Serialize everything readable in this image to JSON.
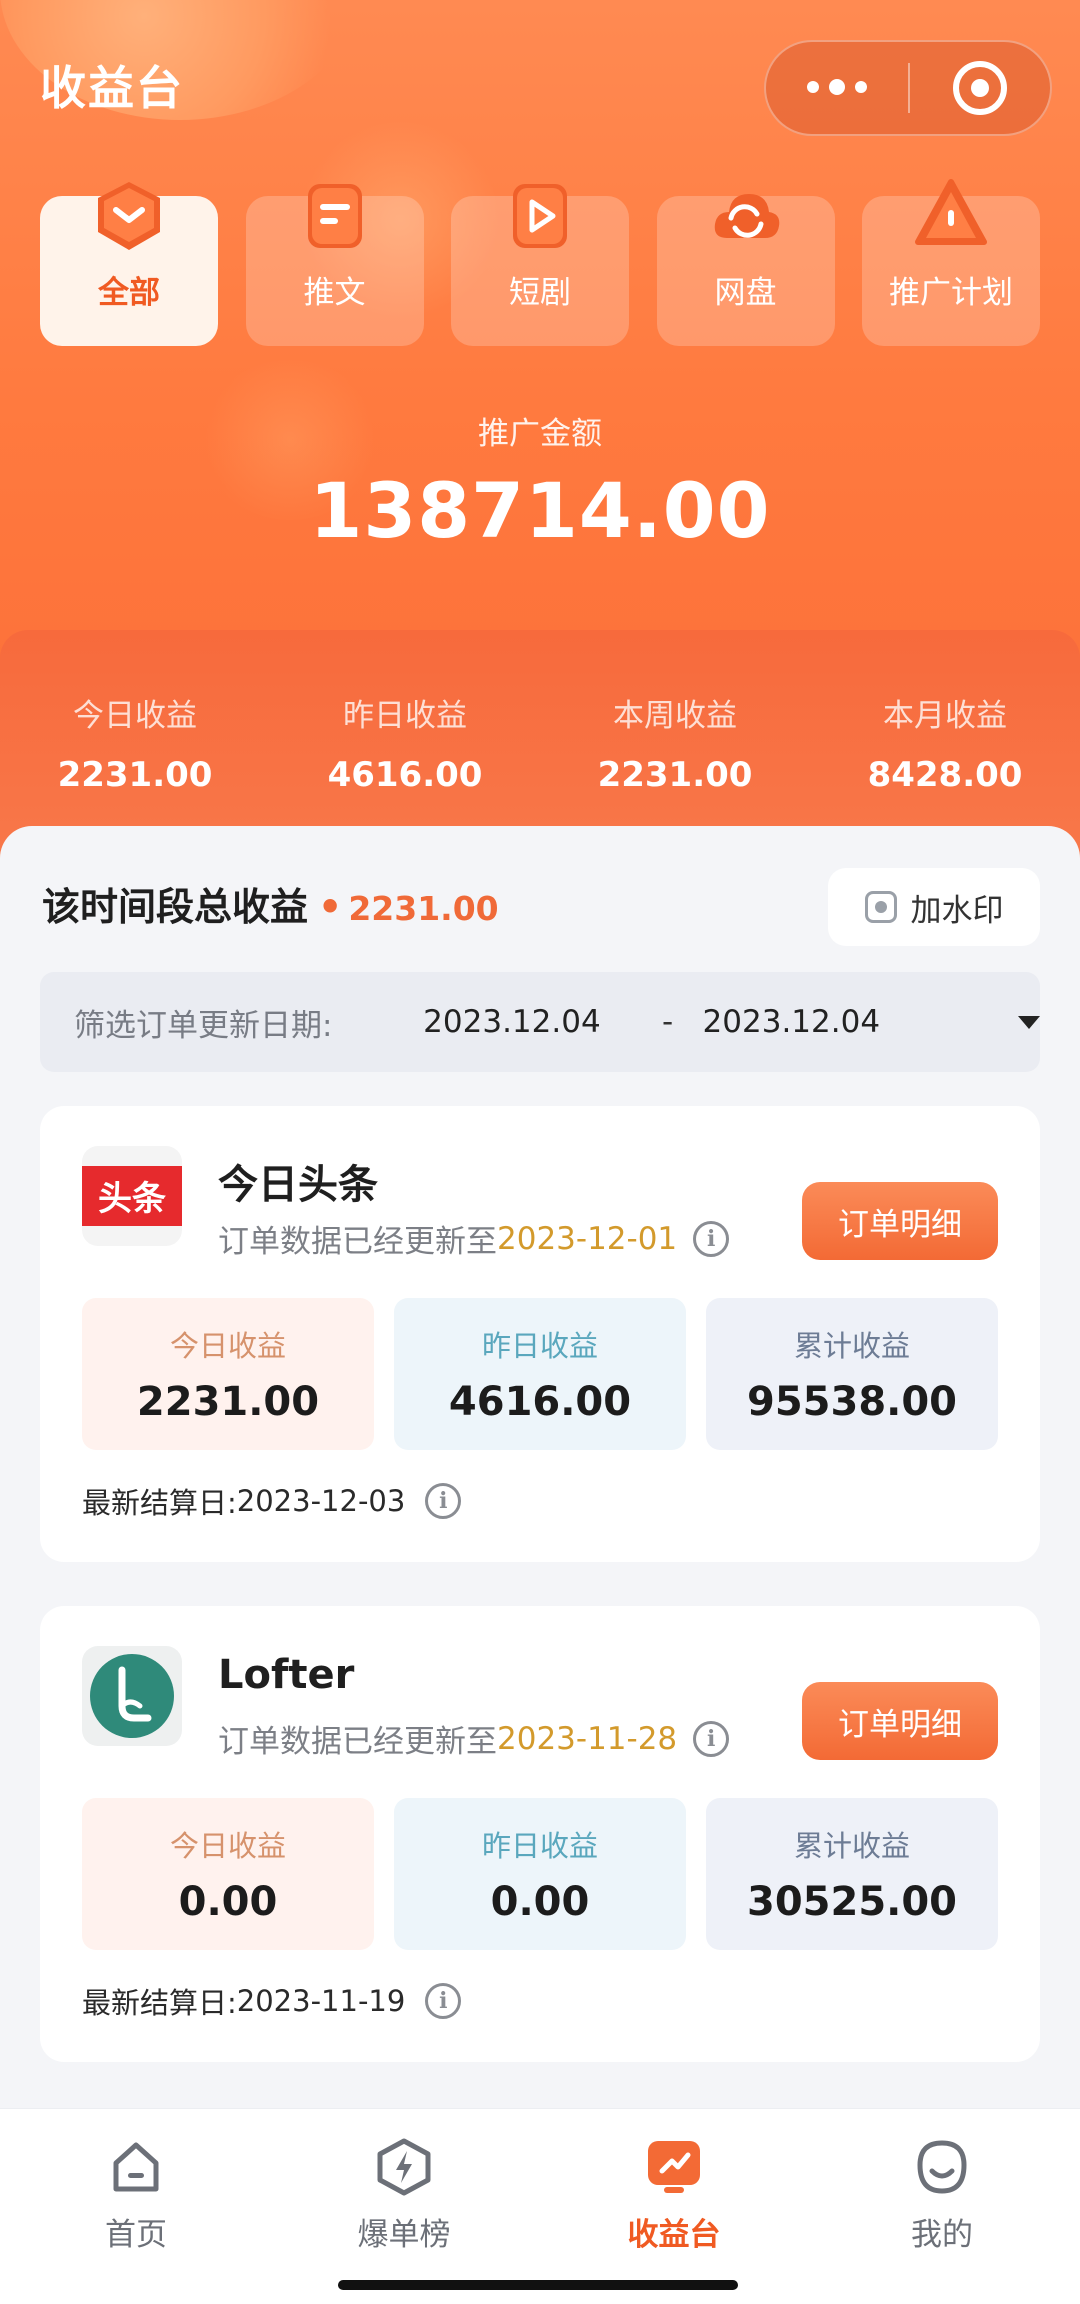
{
  "app": {
    "title": "收益台"
  },
  "categories": [
    {
      "label": "全部",
      "icon": "all-chevron-icon",
      "active": true
    },
    {
      "label": "推文",
      "icon": "article-icon",
      "active": false
    },
    {
      "label": "短剧",
      "icon": "play-icon",
      "active": false
    },
    {
      "label": "网盘",
      "icon": "cloud-sync-icon",
      "active": false
    },
    {
      "label": "推广计划",
      "icon": "warning-triangle-icon",
      "active": false
    }
  ],
  "promo": {
    "label": "推广金额",
    "amount": "138714.00"
  },
  "earnings": [
    {
      "label": "今日收益",
      "value": "2231.00"
    },
    {
      "label": "昨日收益",
      "value": "4616.00"
    },
    {
      "label": "本周收益",
      "value": "2231.00"
    },
    {
      "label": "本月收益",
      "value": "8428.00"
    }
  ],
  "summary": {
    "title": "该时间段总收益",
    "dot": "•",
    "amount": "2231.00",
    "watermark_label": "加水印"
  },
  "filter": {
    "label": "筛选订单更新日期:",
    "start": "2023.12.04",
    "separator": "-",
    "end": "2023.12.04"
  },
  "platforms": [
    {
      "name": "今日头条",
      "logo_text": "头条",
      "update_prefix": "订单数据已经更新至",
      "update_date": "2023-12-01",
      "button": "订单明细",
      "stats": [
        {
          "label": "今日收益",
          "value": "2231.00"
        },
        {
          "label": "昨日收益",
          "value": "4616.00"
        },
        {
          "label": "累计收益",
          "value": "95538.00"
        }
      ],
      "settle_label": "最新结算日:",
      "settle_date": "2023-12-03"
    },
    {
      "name": "Lofter",
      "logo_text": "",
      "update_prefix": "订单数据已经更新至",
      "update_date": "2023-11-28",
      "button": "订单明细",
      "stats": [
        {
          "label": "今日收益",
          "value": "0.00"
        },
        {
          "label": "昨日收益",
          "value": "0.00"
        },
        {
          "label": "累计收益",
          "value": "30525.00"
        }
      ],
      "settle_label": "最新结算日:",
      "settle_date": "2023-11-19"
    }
  ],
  "tabbar": [
    {
      "label": "首页",
      "icon": "home-icon",
      "active": false
    },
    {
      "label": "爆单榜",
      "icon": "lightning-badge-icon",
      "active": false
    },
    {
      "label": "收益台",
      "icon": "earnings-chart-icon",
      "active": true
    },
    {
      "label": "我的",
      "icon": "smiley-profile-icon",
      "active": false
    }
  ],
  "colors": {
    "accent": "#f36a35",
    "hero_top": "#ff8a52",
    "date_highlight": "#d39a2c"
  }
}
